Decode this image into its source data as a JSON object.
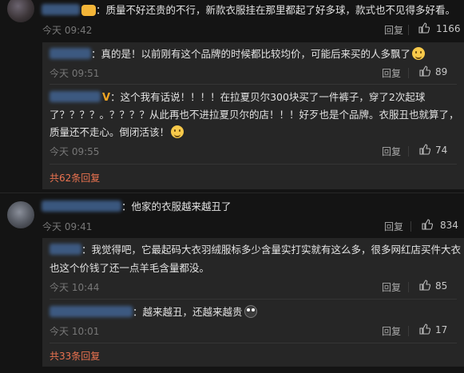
{
  "comments": [
    {
      "text": "：质量不好还贵的不行，新款衣服挂在那里都起了好多球，款式也不见得多好看。",
      "time": "今天 09:42",
      "reply_label": "回复",
      "likes": "1166",
      "replies": [
        {
          "text": "：真的是！以前刚有这个品牌的时候都比较均价，可能后来买的人多飘了",
          "time": "今天 09:51",
          "reply_label": "回复",
          "likes": "89"
        },
        {
          "text_line1": "：这个我有话说！！！！在拉夏贝尔300块买了一件裤子，穿了2次起球",
          "text_line2": "了？？？？。？？？？从此再也不进拉夏贝尔的店！！！好歹也是个品牌。衣服丑也就算了，",
          "text_line3": "质量还不走心。倒闭活该！",
          "badge": "V",
          "time": "今天 09:55",
          "reply_label": "回复",
          "likes": "74"
        }
      ],
      "more_replies": "共62条回复"
    },
    {
      "text": "：他家的衣服越来越丑了",
      "time": "今天 09:41",
      "reply_label": "回复",
      "likes": "834",
      "replies": [
        {
          "text_line1": "：我觉得吧，它最起码大衣羽绒服标多少含量实打实就有这么多，很多网红店买件大衣",
          "text_line2": "也这个价钱了还一点羊毛含量都没。",
          "time": "今天 10:44",
          "reply_label": "回复",
          "likes": "85"
        },
        {
          "text": "：越来越丑，还越来越贵",
          "time": "今天 10:01",
          "reply_label": "回复",
          "likes": "17"
        }
      ],
      "more_replies": "共33条回复"
    }
  ],
  "icons": {
    "thumb": "thumbs-up-icon"
  },
  "colors": {
    "background": "#141414",
    "reply_panel": "#262626",
    "link_orange": "#eb7350",
    "username_blur": "#3f5f8a"
  }
}
